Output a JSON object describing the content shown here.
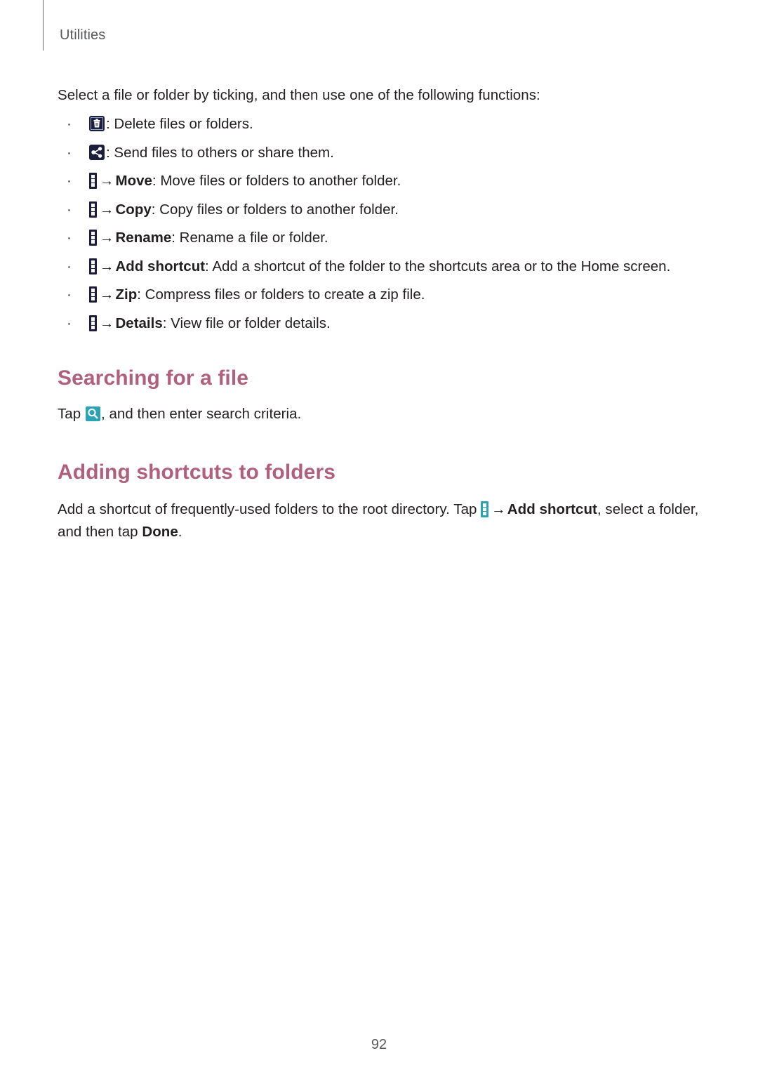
{
  "header": {
    "running_head": "Utilities"
  },
  "intro": {
    "text": "Select a file or folder by ticking, and then use one of the following functions:"
  },
  "functions_list": [
    {
      "icon": "delete-icon",
      "icon_type": "square",
      "has_arrow": false,
      "separator": ":",
      "label": "",
      "description": "Delete files or folders."
    },
    {
      "icon": "share-icon",
      "icon_type": "square",
      "has_arrow": false,
      "separator": ":",
      "label": "",
      "description": "Send files to others or share them."
    },
    {
      "icon": "more-options-icon",
      "icon_type": "menu",
      "has_arrow": true,
      "arrow": "→",
      "separator": ":",
      "label": "Move",
      "description": "Move files or folders to another folder."
    },
    {
      "icon": "more-options-icon",
      "icon_type": "menu",
      "has_arrow": true,
      "arrow": "→",
      "separator": ":",
      "label": "Copy",
      "description": "Copy files or folders to another folder."
    },
    {
      "icon": "more-options-icon",
      "icon_type": "menu",
      "has_arrow": true,
      "arrow": "→",
      "separator": ":",
      "label": "Rename",
      "description": "Rename a file or folder."
    },
    {
      "icon": "more-options-icon",
      "icon_type": "menu",
      "has_arrow": true,
      "arrow": "→",
      "separator": ":",
      "label": "Add shortcut",
      "description": "Add a shortcut of the folder to the shortcuts area or to the Home screen."
    },
    {
      "icon": "more-options-icon",
      "icon_type": "menu",
      "has_arrow": true,
      "arrow": "→",
      "separator": ":",
      "label": "Zip",
      "description": "Compress files or folders to create a zip file."
    },
    {
      "icon": "more-options-icon",
      "icon_type": "menu",
      "has_arrow": true,
      "arrow": "→",
      "separator": ":",
      "label": "Details",
      "description": "View file or folder details."
    }
  ],
  "section_search": {
    "heading": "Searching for a file",
    "body_before": "Tap ",
    "body_after": ", and then enter search criteria."
  },
  "section_add_shortcuts": {
    "heading": "Adding shortcuts to folders",
    "body_1": "Add a shortcut of frequently-used folders to the root directory. Tap ",
    "arrow": "→",
    "bold_1": "Add shortcut",
    "body_2": ", select a folder, and then tap ",
    "bold_2": "Done",
    "body_3": "."
  },
  "footer": {
    "page_number": "92"
  },
  "colors": {
    "heading": "#b05f7c",
    "icon_navy": "#1b1f3b",
    "icon_teal": "#2ba3b5",
    "body_text": "#231f20",
    "running_head": "#58595b"
  }
}
